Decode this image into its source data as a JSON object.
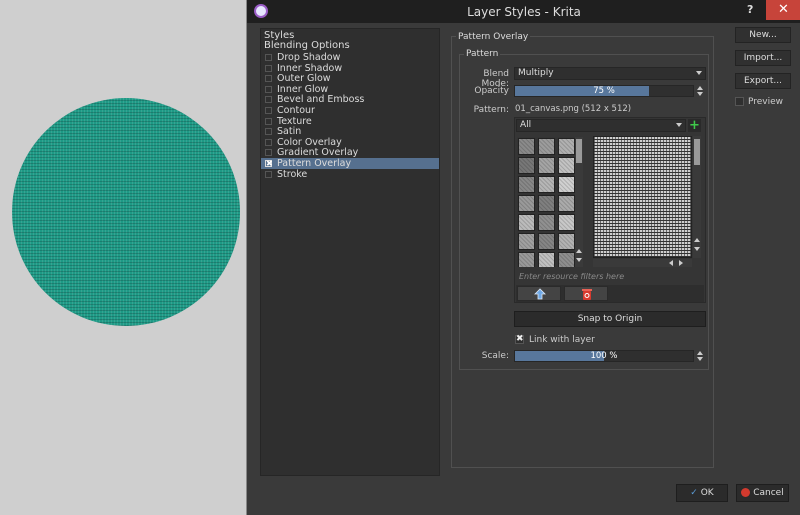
{
  "window": {
    "title": "Layer Styles - Krita",
    "help": "?",
    "close": "✕"
  },
  "styles_list": {
    "header_styles": "Styles",
    "header_blending": "Blending Options",
    "items": [
      {
        "label": "Drop Shadow",
        "checked": false
      },
      {
        "label": "Inner Shadow",
        "checked": false
      },
      {
        "label": "Outer Glow",
        "checked": false
      },
      {
        "label": "Inner Glow",
        "checked": false
      },
      {
        "label": "Bevel and Emboss",
        "checked": false
      },
      {
        "label": "Contour",
        "checked": false
      },
      {
        "label": "Texture",
        "checked": false
      },
      {
        "label": "Satin",
        "checked": false
      },
      {
        "label": "Color Overlay",
        "checked": false
      },
      {
        "label": "Gradient Overlay",
        "checked": false
      },
      {
        "label": "Pattern Overlay",
        "checked": true,
        "selected": true
      },
      {
        "label": "Stroke",
        "checked": false
      }
    ]
  },
  "panel": {
    "group_title": "Pattern Overlay",
    "subgroup_title": "Pattern",
    "blend_mode_label": "Blend Mode:",
    "blend_mode_value": "Multiply",
    "opacity_label": "Opacity",
    "opacity_text": "75 %",
    "opacity_value": 0.75,
    "pattern_label": "Pattern:",
    "pattern_name": "01_canvas.png (512 x 512)",
    "filter_value": "All",
    "filter_placeholder": "Enter resource filters here",
    "add_icon": "+",
    "snap_label": "Snap to Origin",
    "link_label": "Link with layer",
    "link_checked": true,
    "scale_label": "Scale:",
    "scale_text": "100 %",
    "scale_value": 0.5
  },
  "side_buttons": {
    "new": "New...",
    "import": "Import...",
    "export": "Export...",
    "preview": "Preview"
  },
  "footer": {
    "ok": "OK",
    "cancel": "Cancel"
  },
  "colors": {
    "accent": "#56708f",
    "canvas_circle": "#1e9a86",
    "close_red": "#c7443a"
  }
}
